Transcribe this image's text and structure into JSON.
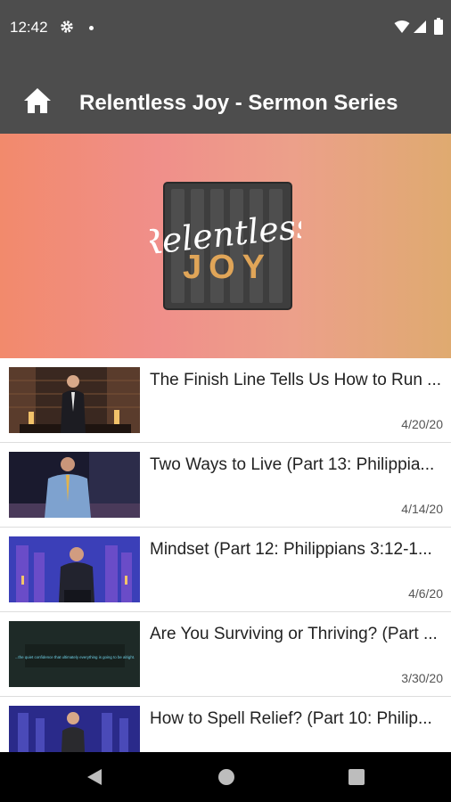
{
  "status": {
    "time": "12:42",
    "icons": [
      "gear-icon",
      "notification-dot",
      "wifi-icon",
      "signal-icon",
      "battery-icon"
    ]
  },
  "header": {
    "title": "Relentless Joy - Sermon Series",
    "home_icon": "home-icon"
  },
  "banner": {
    "logo_script": "Relentless",
    "logo_block": "JOY"
  },
  "sermons": [
    {
      "title": "The Finish Line Tells Us How to Run ...",
      "date": "4/20/20"
    },
    {
      "title": "Two Ways to Live (Part 13: Philippia...",
      "date": "4/14/20"
    },
    {
      "title": "Mindset (Part 12: Philippians 3:12-1...",
      "date": "4/6/20"
    },
    {
      "title": "Are You Surviving or Thriving? (Part ...",
      "date": "3/30/20"
    },
    {
      "title": "How to Spell Relief? (Part 10: Philip...",
      "date": ""
    }
  ],
  "thumbnail_captions": {
    "item_4": "...the quiet confidence that ultimately everything is going to be alright."
  },
  "nav": {
    "back": "back-icon",
    "home": "home-circle-icon",
    "recents": "recents-square-icon"
  },
  "colors": {
    "app_bar": "#4d4d4d",
    "banner_start": "#f28a6c",
    "banner_end": "#dfaa70",
    "logo_gold": "#e0a558"
  }
}
